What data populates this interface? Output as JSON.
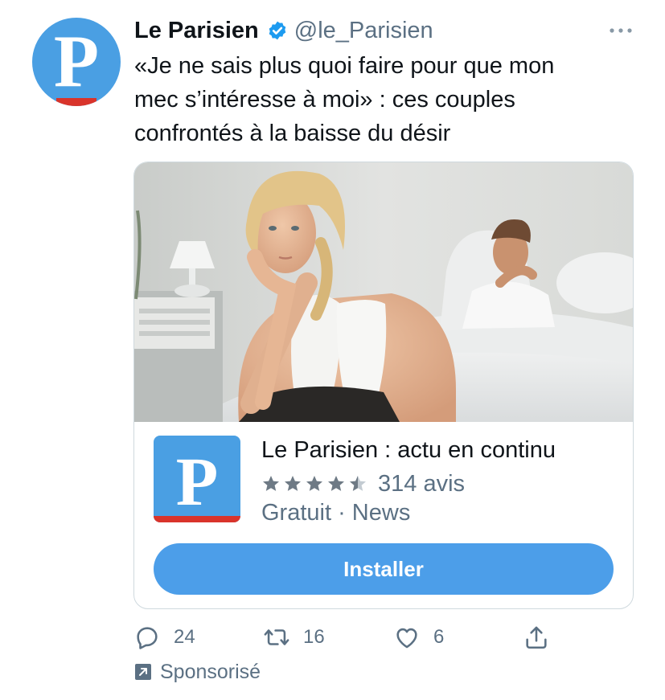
{
  "account": {
    "name": "Le Parisien",
    "handle": "@le_Parisien",
    "avatar_letter": "P"
  },
  "tweet": {
    "lines": [
      "«Je ne sais plus quoi faire pour que mon",
      "mec s’intéresse à moi» : ces couples",
      "confrontés à la baisse du désir"
    ]
  },
  "card": {
    "app_icon_letter": "P",
    "app_title": "Le Parisien : actu en continu",
    "rating_stars": 4.5,
    "reviews": "314 avis",
    "meta": "Gratuit · News",
    "install_label": "Installer"
  },
  "actions": {
    "replies": "24",
    "retweets": "16",
    "likes": "6"
  },
  "sponsored_label": "Sponsorisé",
  "icons": {
    "verified": "verified-badge-icon",
    "more": "more-dots-icon",
    "reply": "reply-icon",
    "retweet": "retweet-icon",
    "like": "heart-icon",
    "share": "share-icon",
    "promoted": "promoted-arrow-icon"
  },
  "colors": {
    "brand_blue": "#4a9fe3",
    "brand_red": "#d9342b",
    "twitter_blue": "#1d9bf0",
    "button_blue": "#4c9ee9",
    "muted_text": "#5b7083"
  }
}
